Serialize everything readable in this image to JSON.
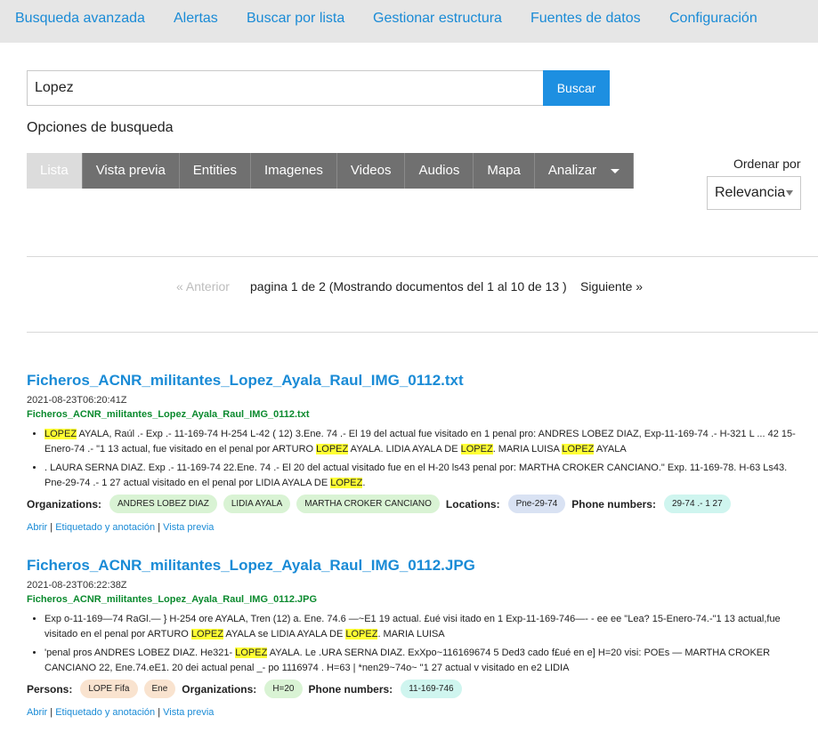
{
  "nav": {
    "items": [
      "Busqueda avanzada",
      "Alertas",
      "Buscar por lista",
      "Gestionar estructura",
      "Fuentes de datos",
      "Configuración"
    ]
  },
  "search": {
    "value": "Lopez",
    "button_label": "Buscar"
  },
  "options": {
    "title": "Opciones de busqueda",
    "tabs": [
      "Lista",
      "Vista previa",
      "Entities",
      "Imagenes",
      "Videos",
      "Audios",
      "Mapa",
      "Analizar"
    ],
    "active_tab": "Lista"
  },
  "sort": {
    "label": "Ordenar por",
    "selected": "Relevancia"
  },
  "pager": {
    "prev_label": "«   Anterior",
    "info": "pagina 1 de 2 (Mostrando documentos del 1 al 10 de 13 )",
    "next_label": "Siguiente    »"
  },
  "results": [
    {
      "title": "Ficheros_ACNR_militantes_Lopez_Ayala_Raul_IMG_0112.txt",
      "date": "2021-08-23T06:20:41Z",
      "filename": "Ficheros_ACNR_militantes_Lopez_Ayala_Raul_IMG_0112.txt",
      "snippets": [
        [
          {
            "t": "LOPEZ",
            "h": true
          },
          {
            "t": " AYALA, Raúl .- Exp .- 11-169-74 H-254 L-42 ( 12) 3.Ene. 74 .- El 19 del actual fue visitado en 1 penal pro: ANDRES LOBEZ DIAZ, Exp-11-169-74 .- H-321 L ... 42 15-Enero-74 .- \"1 13 actual, fue visitado en el penal por ARTURO "
          },
          {
            "t": "LOPEZ",
            "h": true
          },
          {
            "t": " AYALA. LIDIA AYALA DE "
          },
          {
            "t": "LOPEZ",
            "h": true
          },
          {
            "t": ". MARIA LUISA "
          },
          {
            "t": "LOPEZ",
            "h": true
          },
          {
            "t": " AYALA"
          }
        ],
        [
          {
            "t": ". LAURA SERNA DIAZ. Exp .- 11-169-74 22.Ene. 74 .- El 20 del actual visitado fue en el H-20 ls43 penal por: MARTHA CROKER CANCIANO.\" Exp. 11-169-78. H-63 Ls43. Pne-29-74 .- 1 27 actual visitado en el penal por LIDIA AYALA DE "
          },
          {
            "t": "LOPEZ",
            "h": true
          },
          {
            "t": "."
          }
        ]
      ],
      "entity_groups": [
        {
          "label": "Organizations:",
          "kind": "org",
          "values": [
            "ANDRES LOBEZ DIAZ",
            "LIDIA AYALA",
            "MARTHA CROKER CANCIANO"
          ]
        },
        {
          "label": "Locations:",
          "kind": "loc",
          "values": [
            "Pne-29-74"
          ]
        },
        {
          "label": "Phone numbers:",
          "kind": "phone",
          "values": [
            "29-74 .- 1 27"
          ]
        }
      ],
      "links": [
        "Abrir",
        "Etiquetado y anotación",
        "Vista previa"
      ]
    },
    {
      "title": "Ficheros_ACNR_militantes_Lopez_Ayala_Raul_IMG_0112.JPG",
      "date": "2021-08-23T06:22:38Z",
      "filename": "Ficheros_ACNR_militantes_Lopez_Ayala_Raul_IMG_0112.JPG",
      "snippets": [
        [
          {
            "t": "Exp o-11-169—74 RaGl.— } H-254 ore AYALA, Tren (12) a. Ene. 74.6 —~E1 19 actual. £ué visi itado en 1 Exp-11-169-746—- - ee ee \"Lea? 15-Enero-74.-\"1 13 actual,fue visitado en el penal por ARTURO "
          },
          {
            "t": "LOPEZ",
            "h": true
          },
          {
            "t": " AYALA se LIDIA AYALA DE "
          },
          {
            "t": "LOPEZ",
            "h": true
          },
          {
            "t": ". MARIA LUISA"
          }
        ],
        [
          {
            "t": "'penal pros ANDRES LOBEZ DIAZ. He321- "
          },
          {
            "t": "LOPEZ",
            "h": true
          },
          {
            "t": " AYALA. Le .URA SERNA DIAZ. ExXpo~116169674 5 Ded3 cado f£ué en e] H=20 visi: POEs — MARTHA CROKER CANCIANO 22, Ene.74.eE1. 20 dei actual penal _- po 1116974 . H=63 | *nen29~74o~ \"1 27 actual v visitado en e2 LIDIA"
          }
        ]
      ],
      "entity_groups": [
        {
          "label": "Persons:",
          "kind": "person",
          "values": [
            "LOPE Fifa",
            "Ene"
          ]
        },
        {
          "label": "Organizations:",
          "kind": "org",
          "values": [
            "H=20"
          ]
        },
        {
          "label": "Phone numbers:",
          "kind": "phone",
          "values": [
            "11-169-746"
          ]
        }
      ],
      "links": [
        "Abrir",
        "Etiquetado y anotación",
        "Vista previa"
      ]
    }
  ]
}
